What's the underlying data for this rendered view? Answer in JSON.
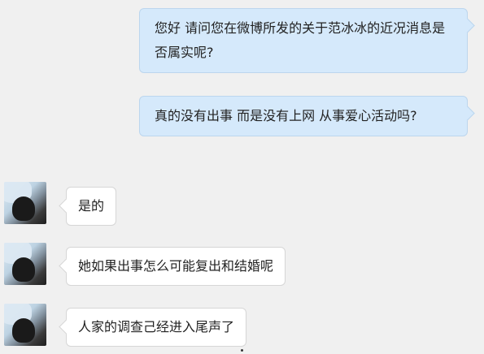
{
  "messages": [
    {
      "side": "out",
      "text": "您好 请问您在微博所发的关于范冰冰的近况消息是否属实呢?"
    },
    {
      "side": "out",
      "text": "真的没有出事 而是没有上网 从事爱心活动吗?"
    },
    {
      "side": "in",
      "text": "是的"
    },
    {
      "side": "in",
      "text": "她如果出事怎么可能复出和结婚呢"
    },
    {
      "side": "in",
      "text": "人家的调查己经进入尾声了"
    }
  ],
  "colors": {
    "background": "#f0f0f0",
    "outgoing_bubble": "#d5e9fb",
    "incoming_bubble": "#ffffff"
  }
}
